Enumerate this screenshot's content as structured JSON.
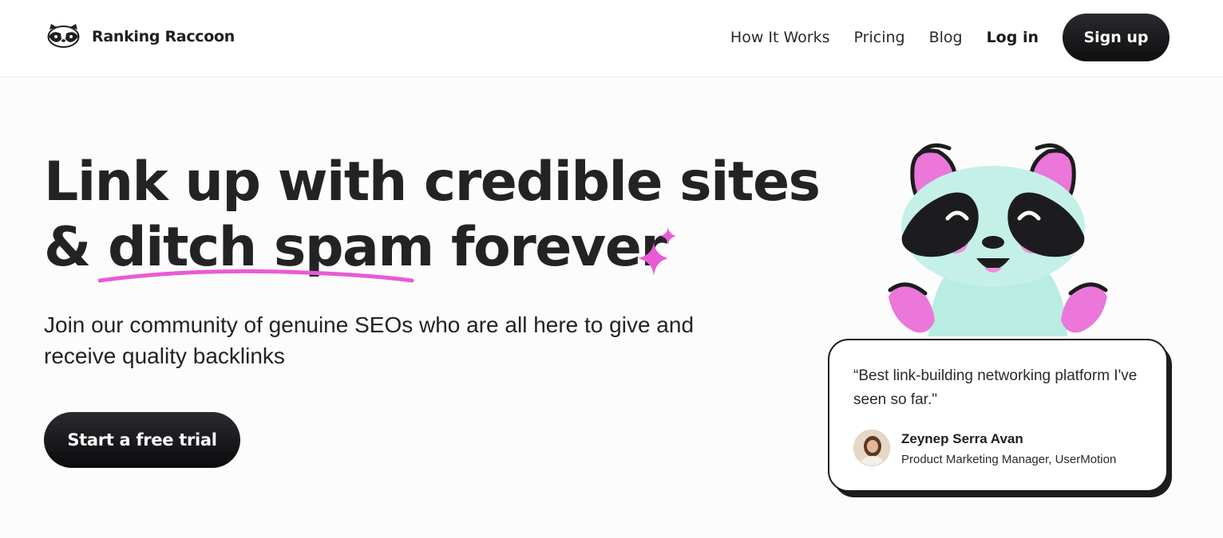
{
  "brand": {
    "name": "Ranking Raccoon",
    "logo_icon": "raccoon-logo-icon"
  },
  "nav": {
    "links": [
      "How It Works",
      "Pricing",
      "Blog"
    ],
    "login": "Log in",
    "signup": "Sign up"
  },
  "hero": {
    "headline_line1": "Link up with credible sites",
    "headline_amp": "& ",
    "headline_highlight": "ditch spam",
    "headline_end": " forever",
    "subtitle": "Join our community of genuine SEOs who are all here to give and receive quality backlinks",
    "cta": "Start a free trial"
  },
  "testimonial": {
    "quote": "“Best link-building networking platform I've seen so far.\"",
    "author": "Zeynep Serra Avan",
    "role": "Product Marketing Manager, UserMotion"
  },
  "colors": {
    "accent_pink": "#e85bd4",
    "raccoon_mint": "#b9ece2",
    "dark": "#1c1c1e"
  }
}
